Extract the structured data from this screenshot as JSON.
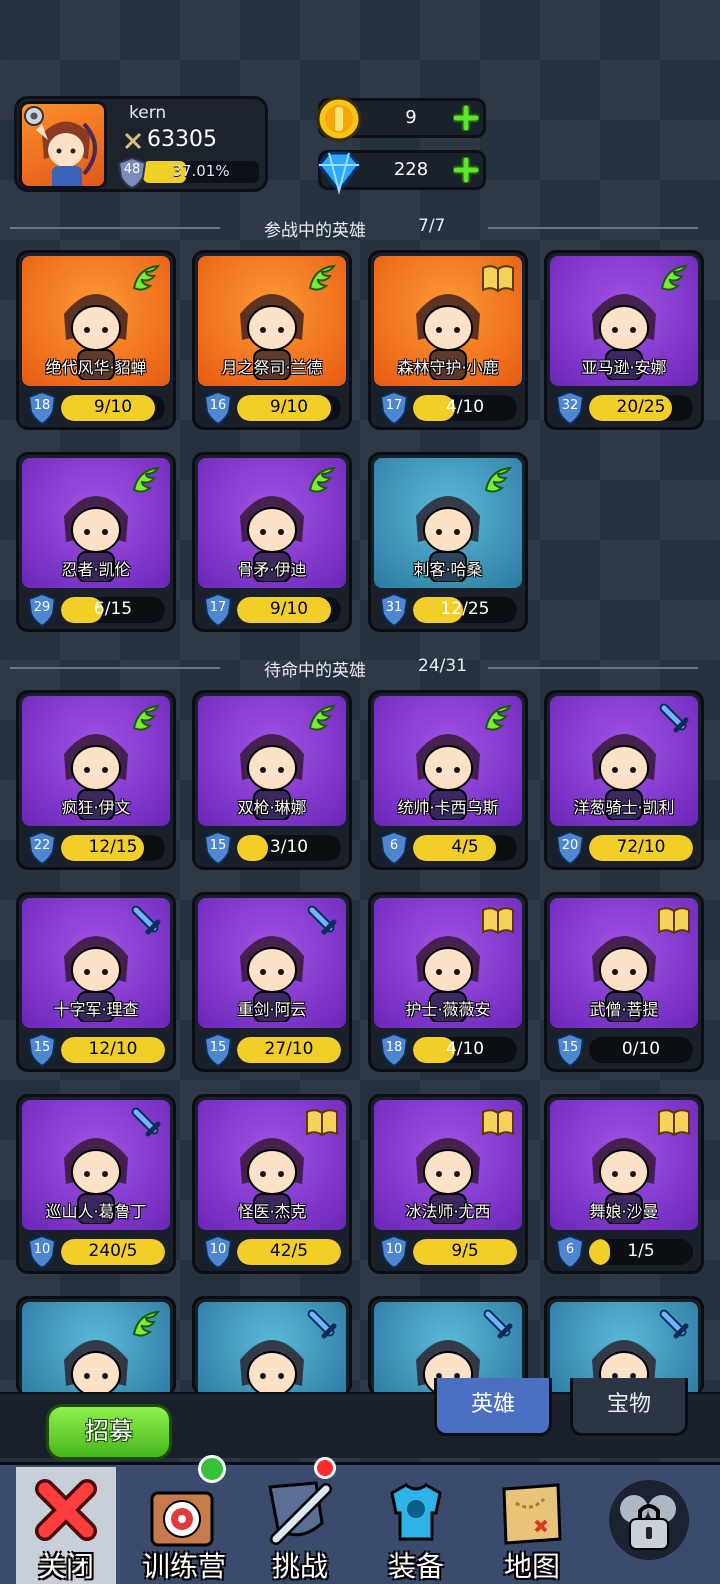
{
  "player": {
    "name": "kern",
    "power": "63305",
    "level": "48",
    "xp_text": "37.01%",
    "xp_fraction": 0.3701
  },
  "currencies": {
    "gold": "9",
    "gems": "228"
  },
  "sections": {
    "deployed_title": "参战中的英雄",
    "deployed_count": "7/7",
    "standby_title": "待命中的英雄",
    "standby_count": "24/31"
  },
  "deployed_heroes": [
    {
      "name": "绝代风华·貂蝉",
      "level": "18",
      "shards": "9/10",
      "fill": 0.9,
      "bg": "orange",
      "type": "wing-icon"
    },
    {
      "name": "月之祭司·兰德",
      "level": "16",
      "shards": "9/10",
      "fill": 0.9,
      "bg": "orange",
      "type": "wing-icon"
    },
    {
      "name": "森林守护·小鹿",
      "level": "17",
      "shards": "4/10",
      "fill": 0.4,
      "bg": "orange",
      "type": "book-icon"
    },
    {
      "name": "亚马逊·安娜",
      "level": "32",
      "shards": "20/25",
      "fill": 0.8,
      "bg": "purple",
      "type": "wing-icon"
    },
    {
      "name": "忍者·凯伦",
      "level": "29",
      "shards": "6/15",
      "fill": 0.4,
      "bg": "purple",
      "type": "wing-icon"
    },
    {
      "name": "骨矛·伊迪",
      "level": "17",
      "shards": "9/10",
      "fill": 0.9,
      "bg": "purple",
      "type": "wing-icon"
    },
    {
      "name": "刺客·哈桑",
      "level": "31",
      "shards": "12/25",
      "fill": 0.48,
      "bg": "blue",
      "type": "wing-icon"
    }
  ],
  "standby_heroes": [
    {
      "name": "疯狂·伊文",
      "level": "22",
      "shards": "12/15",
      "fill": 0.8,
      "bg": "purple",
      "type": "wing-icon"
    },
    {
      "name": "双枪·琳娜",
      "level": "15",
      "shards": "3/10",
      "fill": 0.3,
      "bg": "purple",
      "type": "wing-icon"
    },
    {
      "name": "统帅·卡西乌斯",
      "level": "6",
      "shards": "4/5",
      "fill": 0.8,
      "bg": "purple",
      "type": "wing-icon"
    },
    {
      "name": "洋葱骑士·凯利",
      "level": "20",
      "shards": "72/10",
      "fill": 1,
      "bg": "purple",
      "type": "sword-icon"
    },
    {
      "name": "十字军·理查",
      "level": "15",
      "shards": "12/10",
      "fill": 1,
      "bg": "purple",
      "type": "sword-icon"
    },
    {
      "name": "重剑·阿云",
      "level": "15",
      "shards": "27/10",
      "fill": 1,
      "bg": "purple",
      "type": "sword-icon"
    },
    {
      "name": "护士·薇薇安",
      "level": "18",
      "shards": "4/10",
      "fill": 0.4,
      "bg": "purple",
      "type": "book-icon"
    },
    {
      "name": "武僧·菩提",
      "level": "15",
      "shards": "0/10",
      "fill": 0,
      "bg": "purple",
      "type": "book-icon"
    },
    {
      "name": "巡山人·葛鲁丁",
      "level": "10",
      "shards": "240/5",
      "fill": 1,
      "bg": "purple",
      "type": "sword-icon"
    },
    {
      "name": "怪医·杰克",
      "level": "10",
      "shards": "42/5",
      "fill": 1,
      "bg": "purple",
      "type": "book-icon"
    },
    {
      "name": "冰法师·尤西",
      "level": "10",
      "shards": "9/5",
      "fill": 1,
      "bg": "purple",
      "type": "book-icon"
    },
    {
      "name": "舞娘·沙曼",
      "level": "6",
      "shards": "1/5",
      "fill": 0.2,
      "bg": "purple",
      "type": "book-icon"
    }
  ],
  "partial_row": [
    {
      "bg": "blue",
      "type": "wing-icon"
    },
    {
      "bg": "blue",
      "type": "sword-icon"
    },
    {
      "bg": "blue",
      "type": "sword-icon"
    },
    {
      "bg": "blue",
      "type": "sword-icon"
    }
  ],
  "bottom": {
    "recruit_label": "招募",
    "tab_heroes": "英雄",
    "tab_treasures": "宝物"
  },
  "nav": {
    "close": "关闭",
    "training": "训练营",
    "challenge": "挑战",
    "equipment": "装备",
    "map": "地图"
  },
  "colors": {
    "bar_fill": "#f2cf28",
    "card_orange": "#f07a22",
    "card_purple": "#8a3dd6",
    "card_blue": "#3d98bf"
  }
}
